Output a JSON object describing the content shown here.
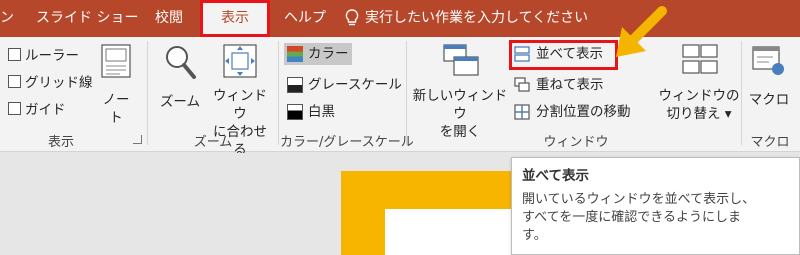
{
  "tabs": [
    {
      "label": "ン"
    },
    {
      "label": "スライド ショー"
    },
    {
      "label": "校閲"
    },
    {
      "label": "表示"
    },
    {
      "label": "ヘルプ"
    }
  ],
  "tell_me": "実行したい作業を入力してください",
  "groups": {
    "show": {
      "label": "表示",
      "ruler": "ルーラー",
      "gridlines": "グリッド線",
      "guides": "ガイド",
      "notes": "ノー\nト"
    },
    "zoom": {
      "label": "ズーム",
      "zoom": "ズーム",
      "fit": "ウィンドウ\nに合わせる"
    },
    "color": {
      "label": "カラー/グレースケール",
      "color": "カラー",
      "grayscale": "グレースケール",
      "bw": "白黒"
    },
    "window": {
      "label": "ウィンドウ",
      "new_window": "新しいウィンドウ\nを開く",
      "arrange_all": "並べて表示",
      "cascade": "重ねて表示",
      "move_split": "分割位置の移動",
      "switch": "ウィンドウの\n切り替え ▾"
    },
    "macro": {
      "label": "マクロ",
      "macros": "マクロ"
    }
  },
  "tooltip": {
    "title": "並べて表示",
    "body": "開いているウィンドウを並べて表示し、\nすべてを一度に確認できるようにしま\nす。"
  },
  "colors": {
    "accent": "#b7472a",
    "highlight_box": "#e8141a",
    "arrow": "#f4b400",
    "slide_accent": "#f8b500"
  }
}
